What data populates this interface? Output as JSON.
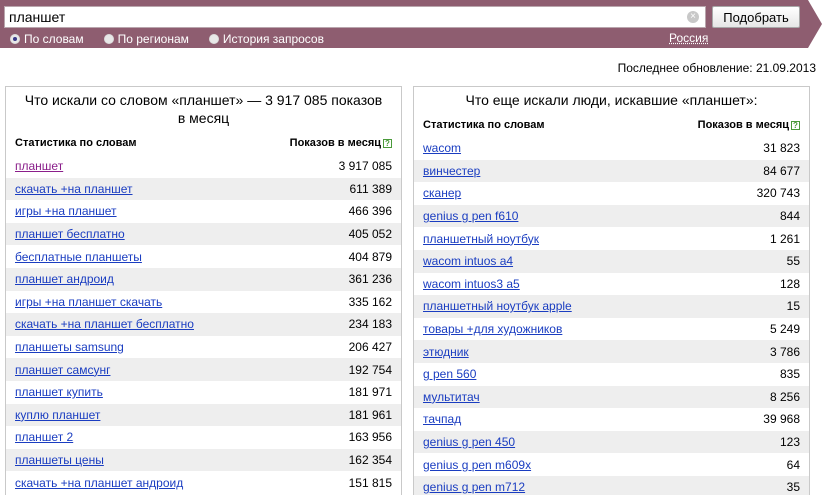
{
  "search": {
    "query": "планшет",
    "submit_label": "Подобрать",
    "clear_glyph": "×",
    "modes": [
      {
        "label": "По словам",
        "checked": true
      },
      {
        "label": "По регионам",
        "checked": false
      },
      {
        "label": "История запросов",
        "checked": false
      }
    ],
    "region": "Россия"
  },
  "colors": {
    "topbar": "#8e5d70",
    "link": "#1a3dc1",
    "visited_link": "#8a1e8a",
    "row_alt": "#eeeeee"
  },
  "updated": "Последнее обновление: 21.09.2013",
  "left": {
    "title": "Что искали со словом «планшет» — 3 917 085 показов в месяц",
    "col_words": "Статистика по словам",
    "col_count": "Показов в месяц",
    "help_glyph": "?",
    "rows": [
      {
        "phrase": "планшет",
        "count": "3 917 085"
      },
      {
        "phrase": "скачать +на планшет",
        "count": "611 389"
      },
      {
        "phrase": "игры +на планшет",
        "count": "466 396"
      },
      {
        "phrase": "планшет бесплатно",
        "count": "405 052"
      },
      {
        "phrase": "бесплатные планшеты",
        "count": "404 879"
      },
      {
        "phrase": "планшет андроид",
        "count": "361 236"
      },
      {
        "phrase": "игры +на планшет скачать",
        "count": "335 162"
      },
      {
        "phrase": "скачать +на планшет бесплатно",
        "count": "234 183"
      },
      {
        "phrase": "планшеты samsung",
        "count": "206 427"
      },
      {
        "phrase": "планшет самсунг",
        "count": "192 754"
      },
      {
        "phrase": "планшет купить",
        "count": "181 971"
      },
      {
        "phrase": "куплю планшет",
        "count": "181 961"
      },
      {
        "phrase": "планшет 2",
        "count": "163 956"
      },
      {
        "phrase": "планшеты цены",
        "count": "162 354"
      },
      {
        "phrase": "скачать +на планшет андроид",
        "count": "151 815"
      }
    ]
  },
  "right": {
    "title": "Что еще искали люди, искавшие «планшет»:",
    "col_words": "Статистика по словам",
    "col_count": "Показов в месяц",
    "help_glyph": "?",
    "rows": [
      {
        "phrase": "wacom",
        "count": "31 823"
      },
      {
        "phrase": "винчестер",
        "count": "84 677"
      },
      {
        "phrase": "сканер",
        "count": "320 743"
      },
      {
        "phrase": "genius g pen f610",
        "count": "844"
      },
      {
        "phrase": "планшетный ноутбук",
        "count": "1 261"
      },
      {
        "phrase": "wacom intuos a4",
        "count": "55"
      },
      {
        "phrase": "wacom intuos3 a5",
        "count": "128"
      },
      {
        "phrase": "планшетный ноутбук apple",
        "count": "15"
      },
      {
        "phrase": "товары +для художников",
        "count": "5 249"
      },
      {
        "phrase": "этюдник",
        "count": "3 786"
      },
      {
        "phrase": "g pen 560",
        "count": "835"
      },
      {
        "phrase": "мультитач",
        "count": "8 256"
      },
      {
        "phrase": "тачпад",
        "count": "39 968"
      },
      {
        "phrase": "genius g pen 450",
        "count": "123"
      },
      {
        "phrase": "genius g pen m609x",
        "count": "64"
      },
      {
        "phrase": "genius g pen m712",
        "count": "35"
      }
    ]
  }
}
